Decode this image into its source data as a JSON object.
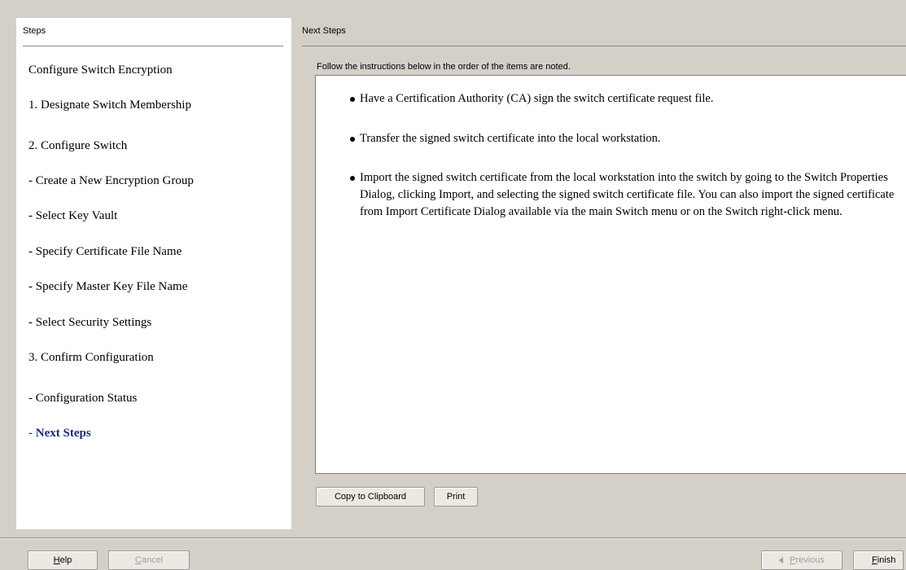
{
  "steps_panel": {
    "header": "Steps",
    "items": [
      {
        "label": "Configure Switch Encryption",
        "active": false
      },
      {
        "label": "1. Designate Switch Membership",
        "active": false
      },
      {
        "label": "2. Configure Switch",
        "active": false
      },
      {
        "label": "- Create a New Encryption Group",
        "active": false
      },
      {
        "label": "- Select Key Vault",
        "active": false
      },
      {
        "label": "- Specify Certificate File Name",
        "active": false
      },
      {
        "label": "- Specify Master Key File Name",
        "active": false
      },
      {
        "label": "- Select Security Settings",
        "active": false
      },
      {
        "label": "3. Confirm Configuration",
        "active": false
      },
      {
        "label": "- Configuration Status",
        "active": false
      },
      {
        "label": "- Next Steps",
        "active": true
      }
    ]
  },
  "next_steps": {
    "header": "Next Steps",
    "instructions": "Follow the instructions below in the order of the items are noted.",
    "bullets": [
      "Have a Certification Authority (CA) sign the switch certificate request file.",
      "Transfer the signed switch certificate into the local workstation.",
      "Import the signed switch certificate from the local workstation into the switch by going to the Switch Properties Dialog, clicking Import, and selecting the signed switch certificate file. You can also import the signed certificate from Import Certificate Dialog available via the main Switch menu or on the Switch right-click menu."
    ],
    "copy_button": "Copy to Clipboard",
    "print_button": "Print"
  },
  "footer": {
    "help": {
      "first": "H",
      "rest": "elp"
    },
    "cancel": {
      "first": "C",
      "rest": "ancel"
    },
    "previous": {
      "first": "P",
      "rest": "revious"
    },
    "finish": {
      "first": "F",
      "rest": "inish"
    }
  }
}
